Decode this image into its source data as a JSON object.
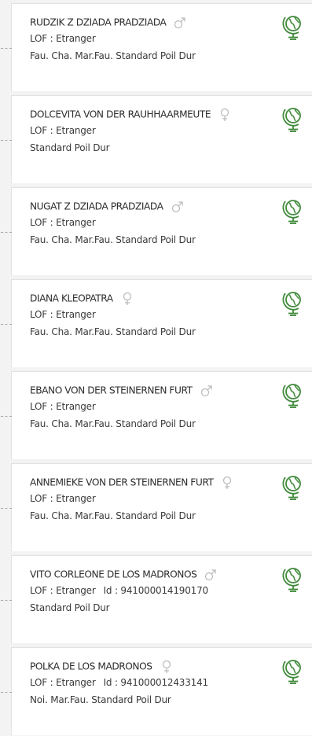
{
  "colors": {
    "name_text": "#2d2d2d",
    "detail_text": "#3a3a3a",
    "sex_symbol": "#b8b8b8",
    "globe_icon": "#3f8a3a",
    "card_background": "#ffffff",
    "page_background": "#f3f3f3",
    "connector": "#a8a8a8"
  },
  "dogs": [
    {
      "name": "RUDZIK Z DZIADA PRADZIADA",
      "sex_icon": "male-icon",
      "lof": "LOF : Etranger",
      "id": "",
      "details": "Fau. Cha. Mar.Fau. Standard Poil Dur"
    },
    {
      "name": "DOLCEVITA VON DER RAUHHAARMEUTE",
      "sex_icon": "female-icon",
      "lof": "LOF : Etranger",
      "id": "",
      "details": "Standard Poil Dur"
    },
    {
      "name": "NUGAT Z DZIADA PRADZIADA",
      "sex_icon": "male-icon",
      "lof": "LOF : Etranger",
      "id": "",
      "details": "Fau. Cha. Mar.Fau. Standard Poil Dur"
    },
    {
      "name": "DIANA KLEOPATRA",
      "sex_icon": "female-icon",
      "lof": "LOF : Etranger",
      "id": "",
      "details": "Fau. Cha. Mar.Fau. Standard Poil Dur"
    },
    {
      "name": "EBANO VON DER STEINERNEN FURT",
      "sex_icon": "male-icon",
      "lof": "LOF : Etranger",
      "id": "",
      "details": "Fau. Cha. Mar.Fau. Standard Poil Dur"
    },
    {
      "name": "ANNEMIEKE VON DER STEINERNEN FURT",
      "sex_icon": "female-icon",
      "lof": "LOF : Etranger",
      "id": "",
      "details": "Fau. Cha. Mar.Fau. Standard Poil Dur"
    },
    {
      "name": "VITO CORLEONE DE LOS MADRONOS",
      "sex_icon": "male-icon",
      "lof": "LOF : Etranger",
      "id": "Id : 941000014190170",
      "details": "Standard Poil Dur"
    },
    {
      "name": "POLKA DE LOS MADRONOS",
      "sex_icon": "female-icon",
      "lof": "LOF : Etranger",
      "id": "Id : 941000012433141",
      "details": "Noi. Mar.Fau. Standard Poil Dur"
    }
  ],
  "action_icon": "globe-icon"
}
